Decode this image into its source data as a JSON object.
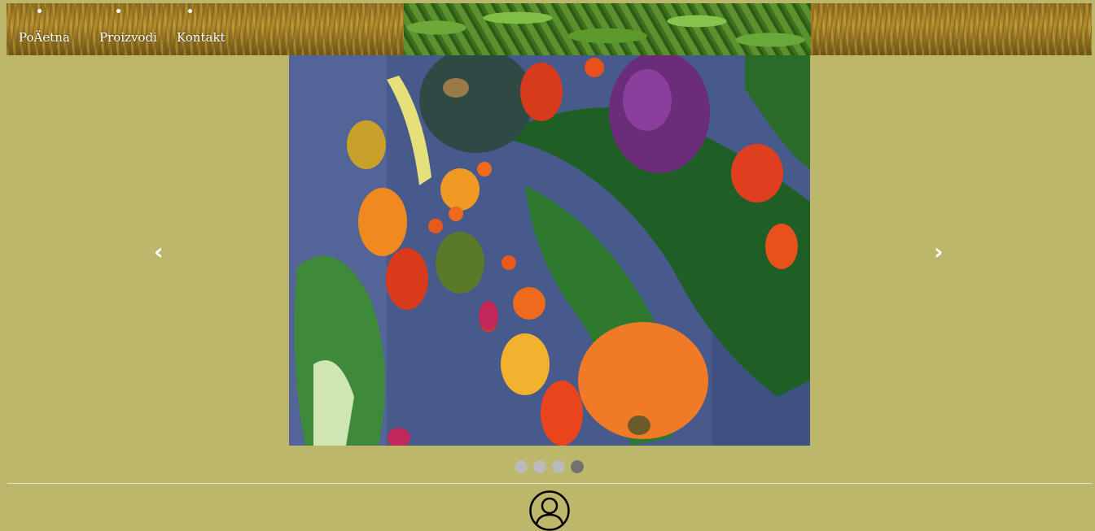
{
  "nav": {
    "items": [
      {
        "label": "PoÄetna"
      },
      {
        "label": "Proizvodi"
      },
      {
        "label": "Kontakt"
      }
    ]
  },
  "slideshow": {
    "prev_arrow": "‹",
    "next_arrow": "›",
    "slide_count": 4,
    "active_index": 3,
    "image": "vegetables-flat-lay"
  },
  "colors": {
    "page_background": "#bdb76b",
    "dot_inactive": "#bbbbbb",
    "dot_active": "#717171",
    "nav_text": "#ffffff"
  },
  "icons": {
    "footer": "user-profile-icon"
  }
}
